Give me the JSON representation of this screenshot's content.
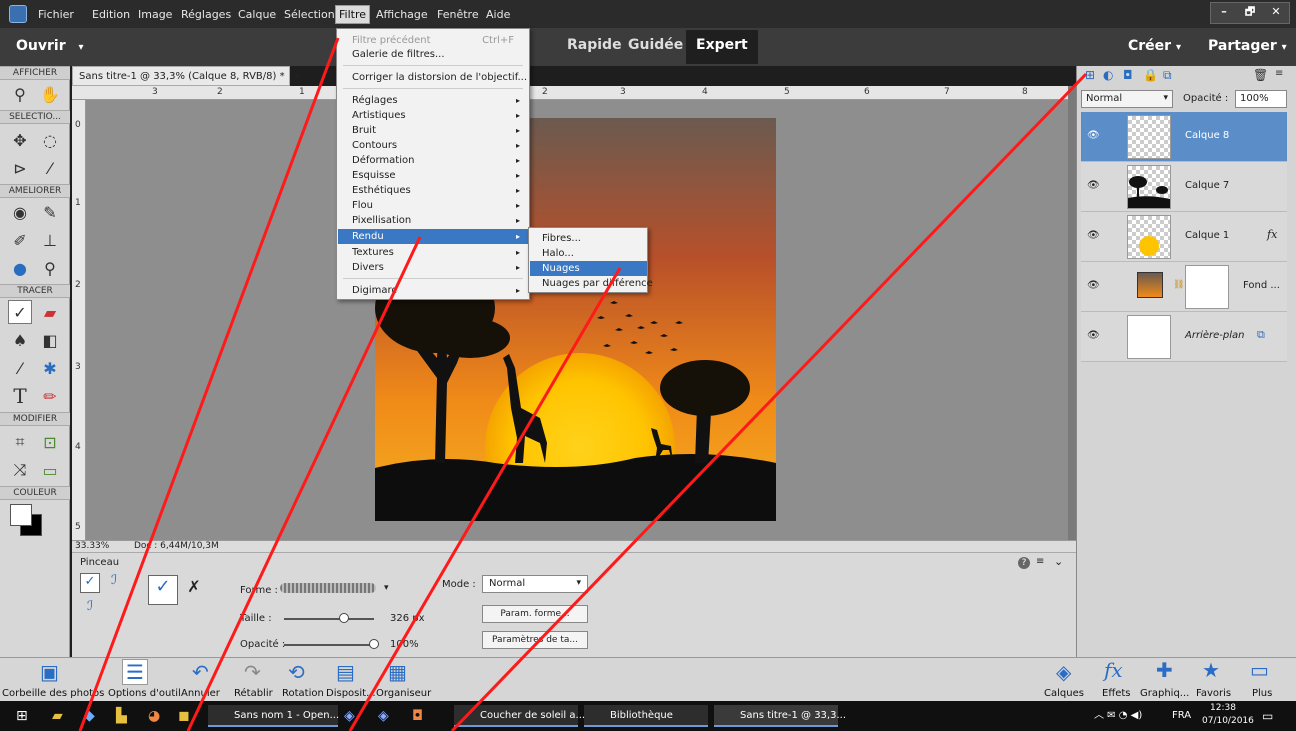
{
  "menubar": {
    "items": [
      "Fichier",
      "Edition",
      "Image",
      "Réglages",
      "Calque",
      "Sélection",
      "Filtre",
      "Affichage",
      "Fenêtre",
      "Aide"
    ],
    "active": "Filtre",
    "window_buttons": [
      "–",
      "🗗",
      "✕"
    ]
  },
  "modebar": {
    "open_label": "Ouvrir",
    "open_caret": "▾",
    "tabs": [
      "Rapide",
      "Guidée",
      "Expert"
    ],
    "active_tab": "Expert",
    "create_label": "Créer",
    "share_label": "Partager",
    "caret": "▾"
  },
  "tools": {
    "sections": [
      "AFFICHER",
      "SELECTIO...",
      "AMELIORER",
      "TRACER",
      "MODIFIER",
      "COULEUR"
    ]
  },
  "document": {
    "tab_title": "Sans titre-1 @ 33,3% (Calque 8, RVB/8) *",
    "close": "×",
    "ruler_h": [
      "3",
      "2",
      "1",
      "2",
      "3",
      "4",
      "5",
      "6",
      "7",
      "8"
    ],
    "ruler_v": [
      "0",
      "1",
      "2",
      "3",
      "4",
      "5"
    ],
    "zoom": "33.33%",
    "doc_info": "Doc : 6,44M/10,3M"
  },
  "filter_menu": {
    "items": [
      {
        "label": "Filtre précédent",
        "shortcut": "Ctrl+F",
        "disabled": true
      },
      {
        "label": "Galerie de filtres..."
      },
      {
        "label": "Corriger la distorsion de l'objectif..."
      },
      {
        "label": "Réglages",
        "sub": true
      },
      {
        "label": "Artistiques",
        "sub": true
      },
      {
        "label": "Bruit",
        "sub": true
      },
      {
        "label": "Contours",
        "sub": true
      },
      {
        "label": "Déformation",
        "sub": true
      },
      {
        "label": "Esquisse",
        "sub": true
      },
      {
        "label": "Esthétiques",
        "sub": true
      },
      {
        "label": "Flou",
        "sub": true
      },
      {
        "label": "Pixellisation",
        "sub": true
      },
      {
        "label": "Rendu",
        "sub": true,
        "highlighted": true
      },
      {
        "label": "Textures",
        "sub": true
      },
      {
        "label": "Divers",
        "sub": true
      },
      {
        "label": "Digimarc",
        "sub": true
      }
    ],
    "submenu_arrow": "▸"
  },
  "render_submenu": {
    "items": [
      "Fibres...",
      "Halo...",
      "Nuages",
      "Nuages par différence"
    ],
    "highlighted": "Nuages"
  },
  "options": {
    "tool_name": "Pinceau",
    "forme_label": "Forme :",
    "taille_label": "Taille :",
    "taille_value": "326 px",
    "opacite_label": "Opacité :",
    "opacite_value": "100%",
    "mode_label": "Mode :",
    "mode_value": "Normal",
    "param_forme": "Param. forme...",
    "param_tablette": "Paramètres de ta...",
    "help": "?",
    "menu_glyph": "≡",
    "collapse": "⌄",
    "size_fraction": 0.67,
    "opacity_fraction": 1.0
  },
  "layers_panel": {
    "blend_mode": "Normal",
    "opacity_label": "Opacité :",
    "opacity_value": "100%",
    "layers": [
      {
        "name": "Calque 8",
        "selected": true,
        "italic": false,
        "fx": ""
      },
      {
        "name": "Calque 7",
        "selected": false,
        "italic": false,
        "fx": ""
      },
      {
        "name": "Calque 1",
        "selected": false,
        "italic": false,
        "fx": "fx"
      },
      {
        "name": "Fond ...",
        "selected": false,
        "italic": false,
        "fx": ""
      },
      {
        "name": "Arrière-plan",
        "selected": false,
        "italic": true,
        "fx": ""
      }
    ]
  },
  "bottom_bar": {
    "left": [
      "Corbeille des photos",
      "Options d'outil",
      "Annuler",
      "Rétablir",
      "Rotation",
      "Disposit...",
      "Organiseur"
    ],
    "right": [
      "Calques",
      "Effets",
      "Graphiq...",
      "Favoris",
      "Plus"
    ]
  },
  "taskbar": {
    "apps": [
      "Sans nom 1 - Open...",
      "Coucher de soleil a...",
      "Bibliothèque",
      "Sans titre-1 @ 33,3..."
    ],
    "lang": "FRA",
    "time": "12:38",
    "date": "07/10/2016"
  },
  "colors": {
    "accent": "#3a78c4",
    "annotation": "#ff0000",
    "sky_top": "#6b5a4f",
    "sky_bottom": "#f0a020"
  }
}
